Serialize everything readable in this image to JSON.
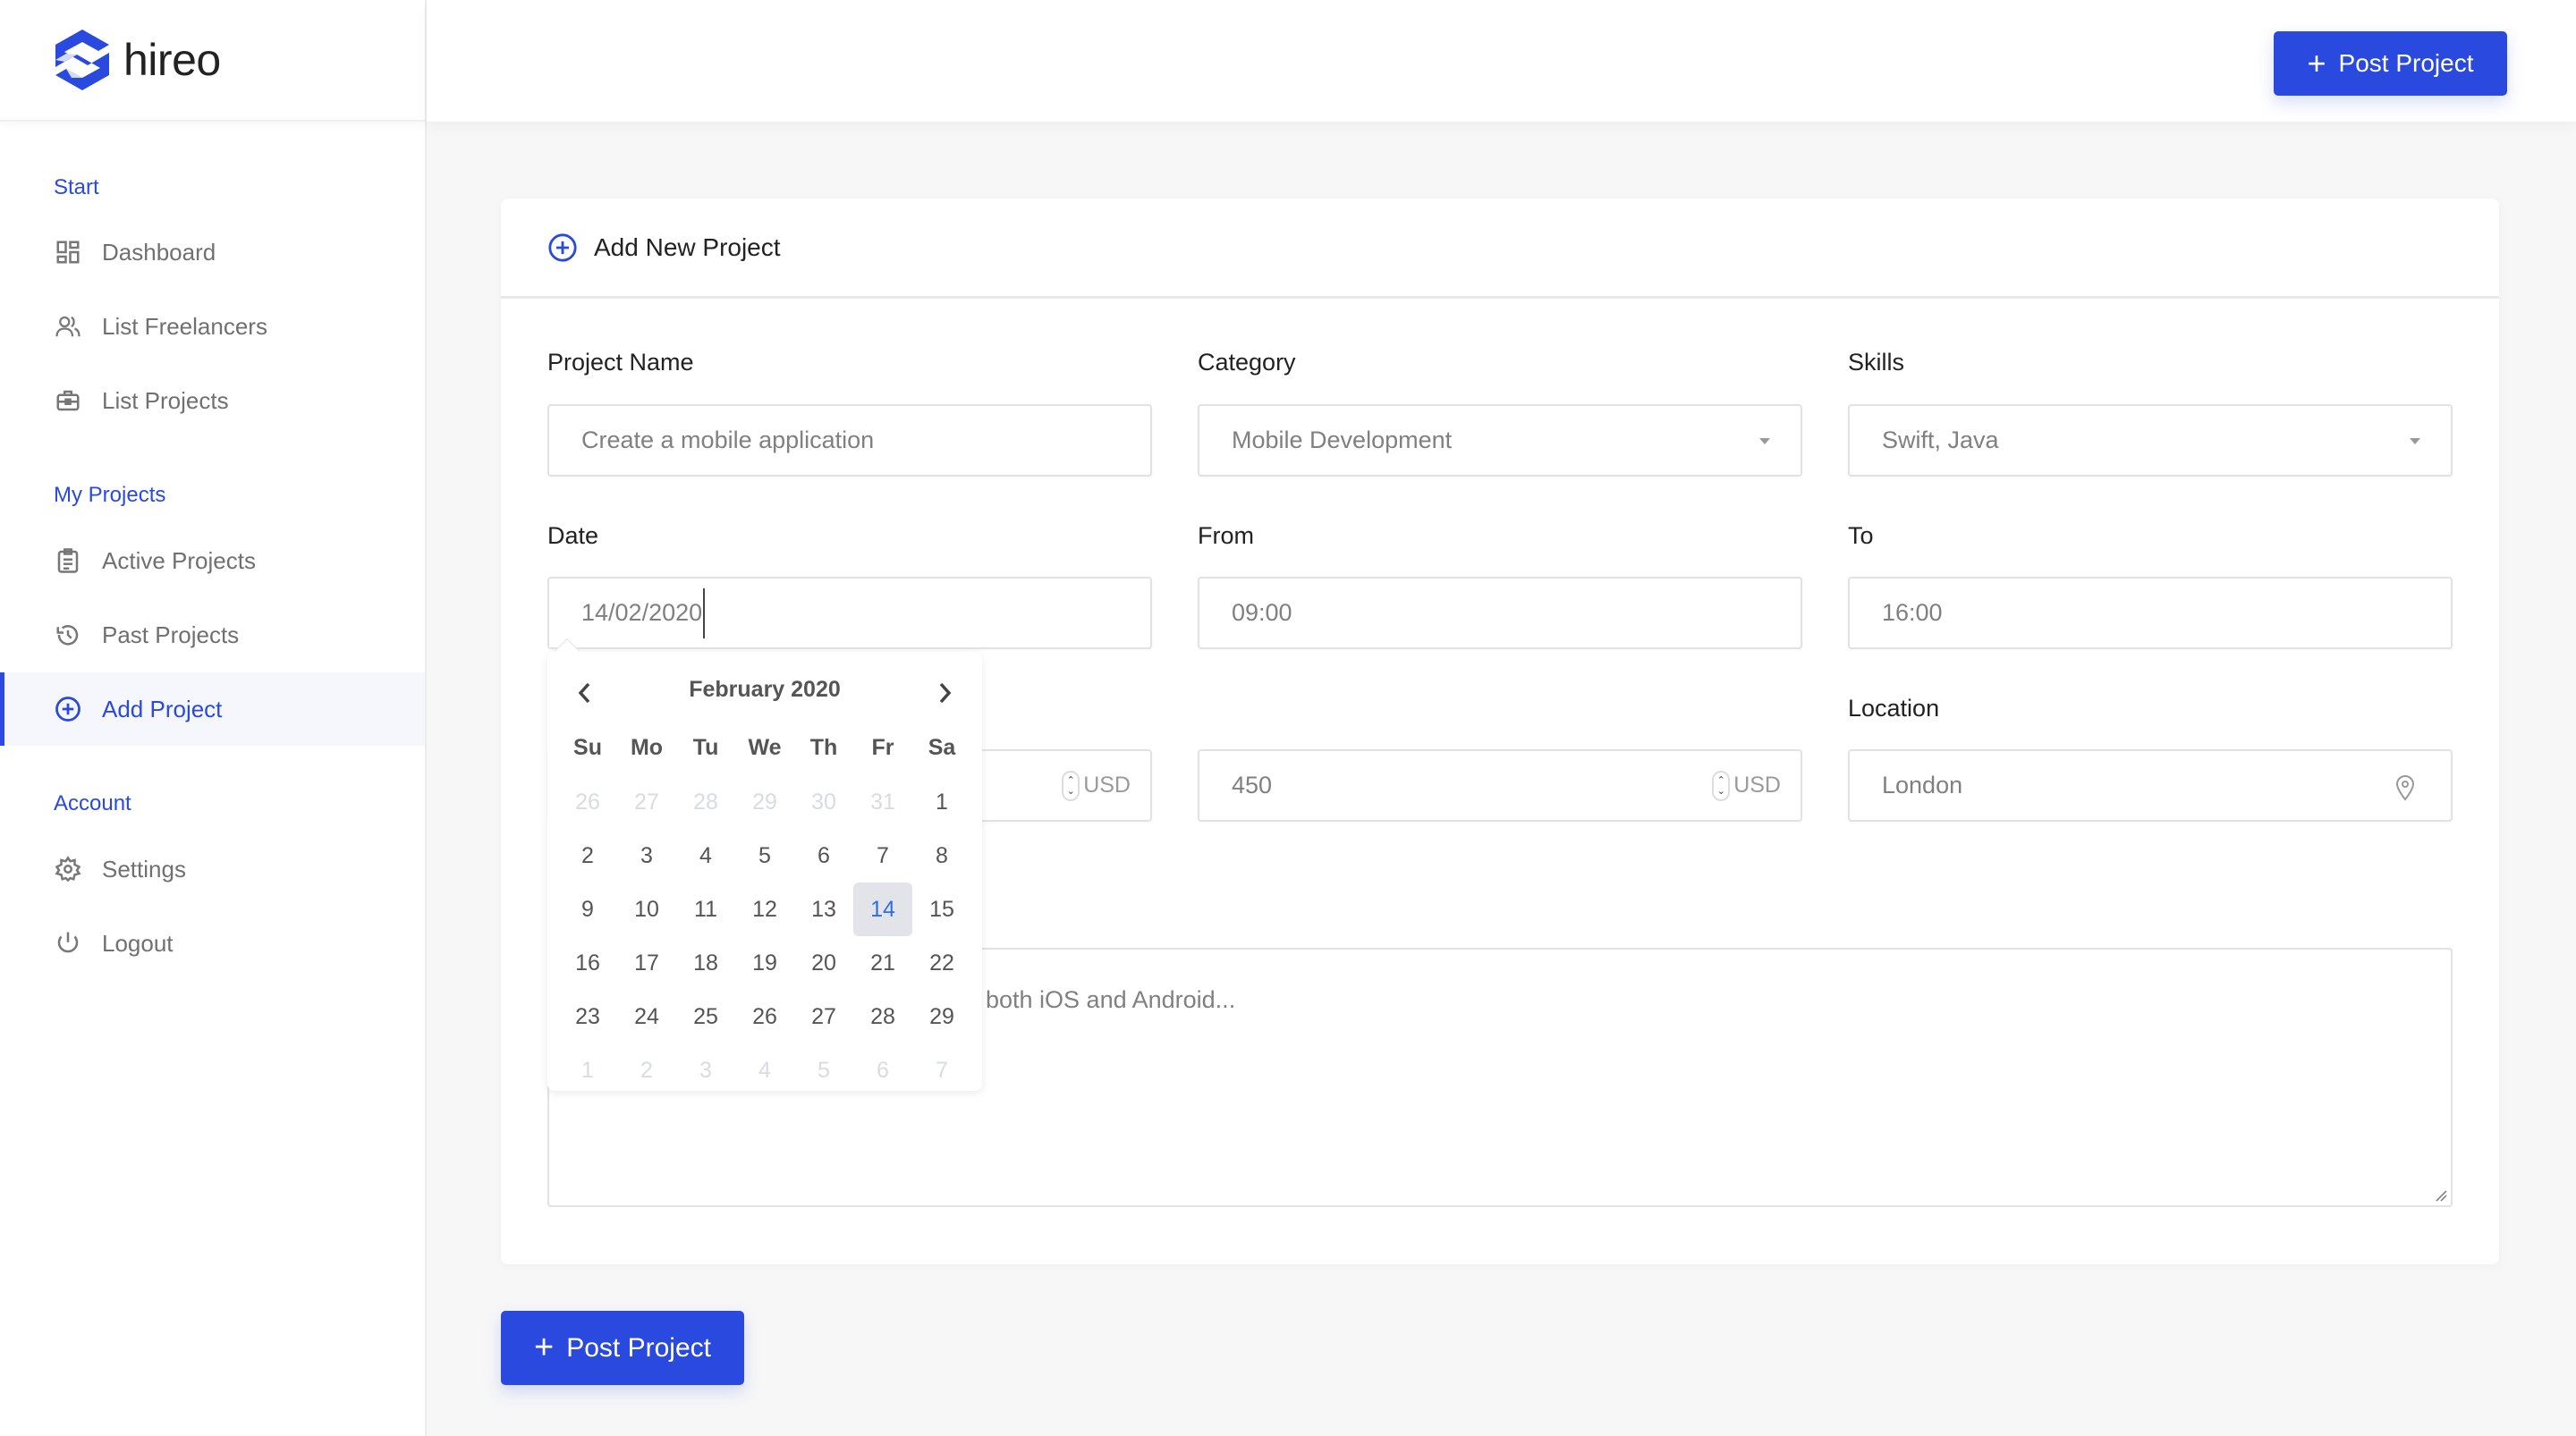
{
  "brand": {
    "name": "hireo",
    "colors": {
      "primary": "#2a49df",
      "selected_day": "#2d6fe5"
    }
  },
  "sidebar": {
    "sections": [
      {
        "heading": "Start",
        "items": [
          {
            "label": "Dashboard",
            "icon": "dashboard-icon"
          },
          {
            "label": "List Freelancers",
            "icon": "users-icon"
          },
          {
            "label": "List Projects",
            "icon": "briefcase-icon"
          }
        ]
      },
      {
        "heading": "My Projects",
        "items": [
          {
            "label": "Active Projects",
            "icon": "clipboard-icon"
          },
          {
            "label": "Past Projects",
            "icon": "history-icon"
          },
          {
            "label": "Add Project",
            "icon": "plus-circle-icon",
            "active": true
          }
        ]
      },
      {
        "heading": "Account",
        "items": [
          {
            "label": "Settings",
            "icon": "gear-icon"
          },
          {
            "label": "Logout",
            "icon": "power-icon"
          }
        ]
      }
    ]
  },
  "header": {
    "post_button": {
      "icon": "+",
      "label": "Post Project"
    }
  },
  "card": {
    "title": "Add New Project",
    "fields": {
      "project_name": {
        "label": "Project Name",
        "placeholder": "Create a mobile application"
      },
      "category": {
        "label": "Category",
        "value": "Mobile Development"
      },
      "skills": {
        "label": "Skills",
        "value": "Swift, Java"
      },
      "date": {
        "label": "Date",
        "value": "14/02/2020"
      },
      "from": {
        "label": "From",
        "value": "09:00"
      },
      "to": {
        "label": "To",
        "value": "16:00"
      },
      "budget_min": {
        "value": "",
        "currency": "USD"
      },
      "budget_max": {
        "value": "450",
        "currency": "USD"
      },
      "location": {
        "label": "Location",
        "value": "London"
      },
      "description": {
        "visible_text": "both iOS and Android..."
      }
    }
  },
  "datepicker": {
    "title": "February 2020",
    "weekdays": [
      "Su",
      "Mo",
      "Tu",
      "We",
      "Th",
      "Fr",
      "Sa"
    ],
    "weeks": [
      [
        {
          "d": "26",
          "m": true
        },
        {
          "d": "27",
          "m": true
        },
        {
          "d": "28",
          "m": true
        },
        {
          "d": "29",
          "m": true
        },
        {
          "d": "30",
          "m": true
        },
        {
          "d": "31",
          "m": true
        },
        {
          "d": "1"
        }
      ],
      [
        {
          "d": "2"
        },
        {
          "d": "3"
        },
        {
          "d": "4"
        },
        {
          "d": "5"
        },
        {
          "d": "6"
        },
        {
          "d": "7"
        },
        {
          "d": "8"
        }
      ],
      [
        {
          "d": "9"
        },
        {
          "d": "10"
        },
        {
          "d": "11"
        },
        {
          "d": "12"
        },
        {
          "d": "13"
        },
        {
          "d": "14",
          "s": true
        },
        {
          "d": "15"
        }
      ],
      [
        {
          "d": "16"
        },
        {
          "d": "17"
        },
        {
          "d": "18"
        },
        {
          "d": "19"
        },
        {
          "d": "20"
        },
        {
          "d": "21"
        },
        {
          "d": "22"
        }
      ],
      [
        {
          "d": "23"
        },
        {
          "d": "24"
        },
        {
          "d": "25"
        },
        {
          "d": "26"
        },
        {
          "d": "27"
        },
        {
          "d": "28"
        },
        {
          "d": "29"
        }
      ],
      [
        {
          "d": "1",
          "m": true
        },
        {
          "d": "2",
          "m": true
        },
        {
          "d": "3",
          "m": true
        },
        {
          "d": "4",
          "m": true
        },
        {
          "d": "5",
          "m": true
        },
        {
          "d": "6",
          "m": true
        },
        {
          "d": "7",
          "m": true
        }
      ]
    ],
    "selected": "14"
  },
  "footer": {
    "post_button": {
      "icon": "+",
      "label": "Post Project"
    }
  }
}
